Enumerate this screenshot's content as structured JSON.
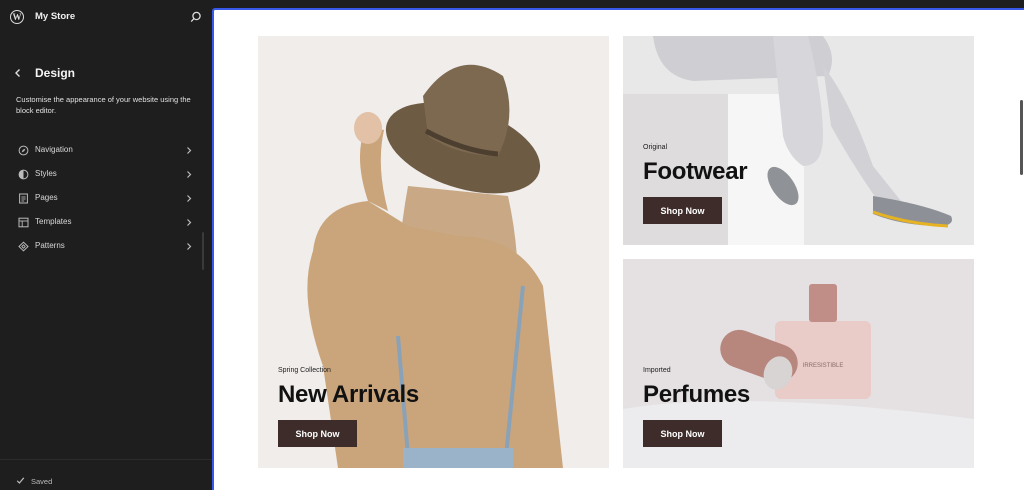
{
  "topbar": {
    "site_title": "My Store"
  },
  "design": {
    "title": "Design",
    "description": "Customise the appearance of your website using the block editor."
  },
  "menu": [
    {
      "label": "Navigation",
      "icon": "navigation-icon"
    },
    {
      "label": "Styles",
      "icon": "styles-icon"
    },
    {
      "label": "Pages",
      "icon": "pages-icon"
    },
    {
      "label": "Templates",
      "icon": "templates-icon"
    },
    {
      "label": "Patterns",
      "icon": "patterns-icon"
    }
  ],
  "footer": {
    "status": "Saved"
  },
  "cards": {
    "arrivals": {
      "eyebrow": "Spring Collection",
      "headline": "New Arrivals",
      "button": "Shop Now"
    },
    "footwear": {
      "eyebrow": "Original",
      "headline": "Footwear",
      "button": "Shop Now"
    },
    "perfumes": {
      "eyebrow": "Imported",
      "headline": "Perfumes",
      "button": "Shop Now"
    }
  },
  "colors": {
    "accent": "#3858e9",
    "sidebar_bg": "#1e1e1e",
    "button_bg": "#3d2c29"
  }
}
